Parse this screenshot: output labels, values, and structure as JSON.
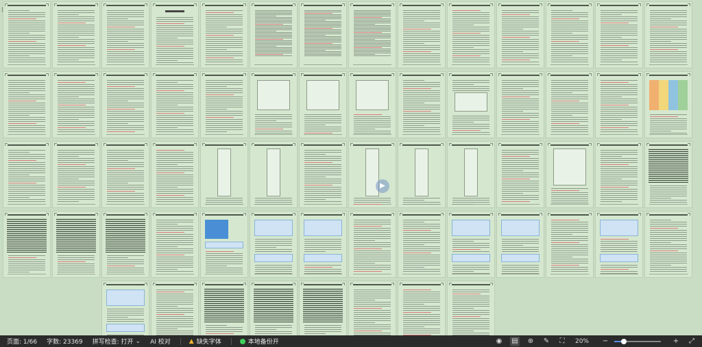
{
  "statusbar": {
    "page": "页面: 1/66",
    "word_count": "字数: 23369",
    "spell_check": "拼写检查: 打开",
    "spell_check_caret": "⌄",
    "ai_proofread": "AI 校对",
    "missing_font": "缺失字体",
    "local_backup": "本地备份开",
    "zoom": "20%",
    "zoom_fraction": 0.2,
    "minus": "−",
    "plus": "+"
  },
  "icons": {
    "play": "▶",
    "eye": "◉",
    "page_view": "▤",
    "web": "⊕",
    "pen": "✎",
    "fit": "⛶",
    "fullscreen": "⤢",
    "warning": "▲",
    "grid": "⠿"
  },
  "colors": {
    "canvas": "#c9dcc4",
    "statusbar": "#2b2b2b",
    "backup_dot": "#3ecf5a",
    "warning": "#f2b530"
  }
}
